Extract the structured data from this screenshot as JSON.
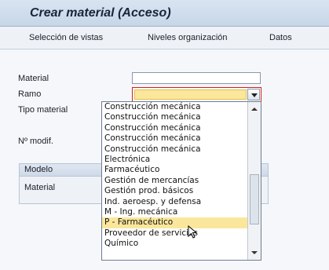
{
  "window": {
    "title": "Crear material (Acceso)"
  },
  "toolbar": {
    "views_label": "Selección de vistas",
    "org_levels_label": "Niveles organización",
    "data_label": "Datos"
  },
  "form": {
    "material_label": "Material",
    "ramo_label": "Ramo",
    "tipo_material_label": "Tipo material",
    "nro_modif_label": "Nº modif."
  },
  "group_box": {
    "header": "Modelo",
    "material_label": "Material"
  },
  "dropdown": {
    "items": [
      "Construcción mecánica",
      "Construcción mecánica",
      "Construcción mecánica",
      "Construcción mecánica",
      "Construcción mecánica",
      "Electrónica",
      "Farmacéutico",
      "Gestión de mercancías",
      "Gestión prod. básicos",
      "Ind. aeroesp. y defensa",
      "M - Ing. mecánica",
      "P - Farmacéutico",
      "Proveedor de servicios",
      "Químico"
    ],
    "selected_index": 11
  },
  "colors": {
    "highlight": "#fbe79c",
    "required_border": "#d11f1f",
    "title_bar": "#c7d6e8"
  }
}
